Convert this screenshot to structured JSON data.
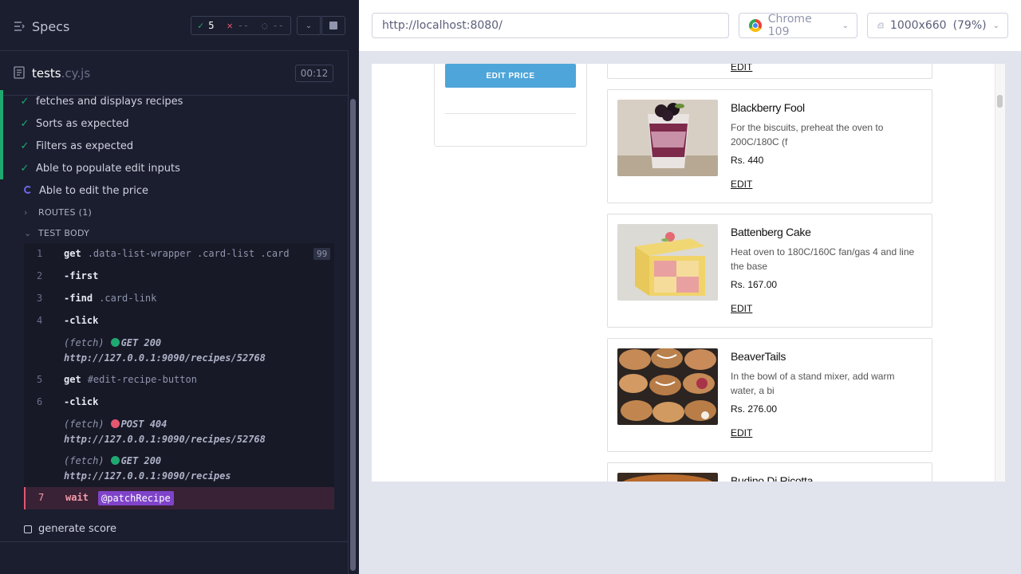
{
  "reporter": {
    "header": {
      "specs_label": "Specs",
      "stats": {
        "passed": "5",
        "failed": "--",
        "pending": "--"
      }
    },
    "file": {
      "name": "tests",
      "ext": ".cy.js",
      "duration": "00:12"
    },
    "tests": [
      {
        "title": "fetches and displays recipes",
        "state": "passed"
      },
      {
        "title": "Sorts as expected",
        "state": "passed"
      },
      {
        "title": "Filters as expected",
        "state": "passed"
      },
      {
        "title": "Able to populate edit inputs",
        "state": "passed"
      },
      {
        "title": "Able to edit the price",
        "state": "running"
      }
    ],
    "routes_label": "ROUTES (1)",
    "test_body_label": "TEST BODY",
    "commands": [
      {
        "num": "1",
        "name": "get",
        "arg": ".data-list-wrapper .card-list .card",
        "badge": "99"
      },
      {
        "num": "2",
        "name": "-first",
        "arg": ""
      },
      {
        "num": "3",
        "name": "-find",
        "arg": ".card-link"
      },
      {
        "num": "4",
        "name": "-click",
        "arg": ""
      },
      {
        "fetch": "(fetch)",
        "method": "GET 200",
        "url": "http://127.0.0.1:9090/recipes/52768"
      },
      {
        "num": "5",
        "name": "get",
        "arg": "#edit-recipe-button"
      },
      {
        "num": "6",
        "name": "-click",
        "arg": ""
      },
      {
        "fetch": "(fetch)",
        "method": "POST 404",
        "url": "http://127.0.0.1:9090/recipes/52768"
      },
      {
        "fetch": "(fetch)",
        "method": "GET 200",
        "url": "http://127.0.0.1:9090/recipes"
      },
      {
        "num": "7",
        "name": "wait",
        "alias": "@patchRecipe"
      }
    ],
    "next_test": "generate score"
  },
  "aut": {
    "url": "http://localhost:8080/",
    "browser": "Chrome 109",
    "viewport": "1000x660",
    "zoom": "(79%)",
    "edit_price_button": "EDIT PRICE",
    "top_card_edit": "EDIT",
    "cards": [
      {
        "title": "Blackberry Fool",
        "desc": "For the biscuits, preheat the oven to 200C/180C (f",
        "price": "Rs. 440",
        "edit": "EDIT"
      },
      {
        "title": "Battenberg Cake",
        "desc": "Heat oven to 180C/160C fan/gas 4 and line the base",
        "price": "Rs. 167.00",
        "edit": "EDIT"
      },
      {
        "title": "BeaverTails",
        "desc": "In the bowl of a stand mixer, add warm water, a bi",
        "price": "Rs. 276.00",
        "edit": "EDIT"
      },
      {
        "title": "Budino Di Ricotta",
        "desc": "",
        "price": "",
        "edit": ""
      }
    ]
  },
  "colors": {
    "pass": "#1fa971",
    "fail": "#e45770",
    "running": "#6f68e8",
    "accent_button": "#4ea5d9",
    "alias": "#7f43c9"
  }
}
